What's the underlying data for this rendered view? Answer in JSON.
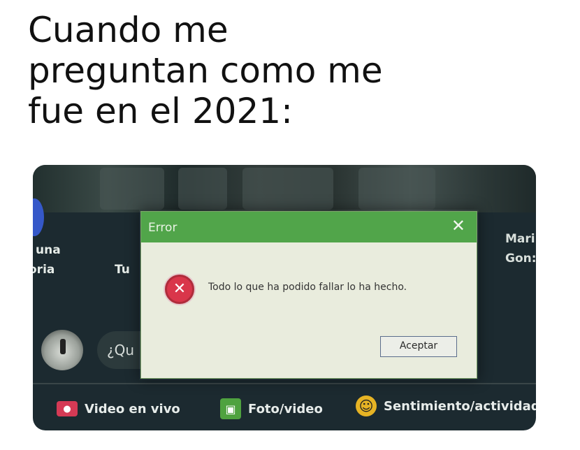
{
  "caption": {
    "lines": [
      "Cuando me",
      "preguntan como me",
      "fue en el 2021:"
    ]
  },
  "background_feed": {
    "left_labels": [
      "una",
      "oria"
    ],
    "middle_label": "Tu",
    "right_labels": [
      "Mari",
      "Gon:"
    ],
    "compose_placeholder": "¿Qu",
    "actions": [
      {
        "label": "Video en vivo",
        "icon": "live-video-icon",
        "color": "#d53a55"
      },
      {
        "label": "Foto/video",
        "icon": "photo-icon",
        "color": "#4fa23f"
      },
      {
        "label": "Sentimiento/actividad",
        "icon": "emoji-icon",
        "color": "#e6b324"
      }
    ]
  },
  "dialog": {
    "title": "Error",
    "close_symbol": "✕",
    "icon": "error-icon",
    "icon_symbol": "✕",
    "message": "Todo lo que ha podido fallar lo ha hecho.",
    "button_label": "Aceptar",
    "titlebar_color": "#51a54a",
    "body_color": "#e9ecdd"
  }
}
